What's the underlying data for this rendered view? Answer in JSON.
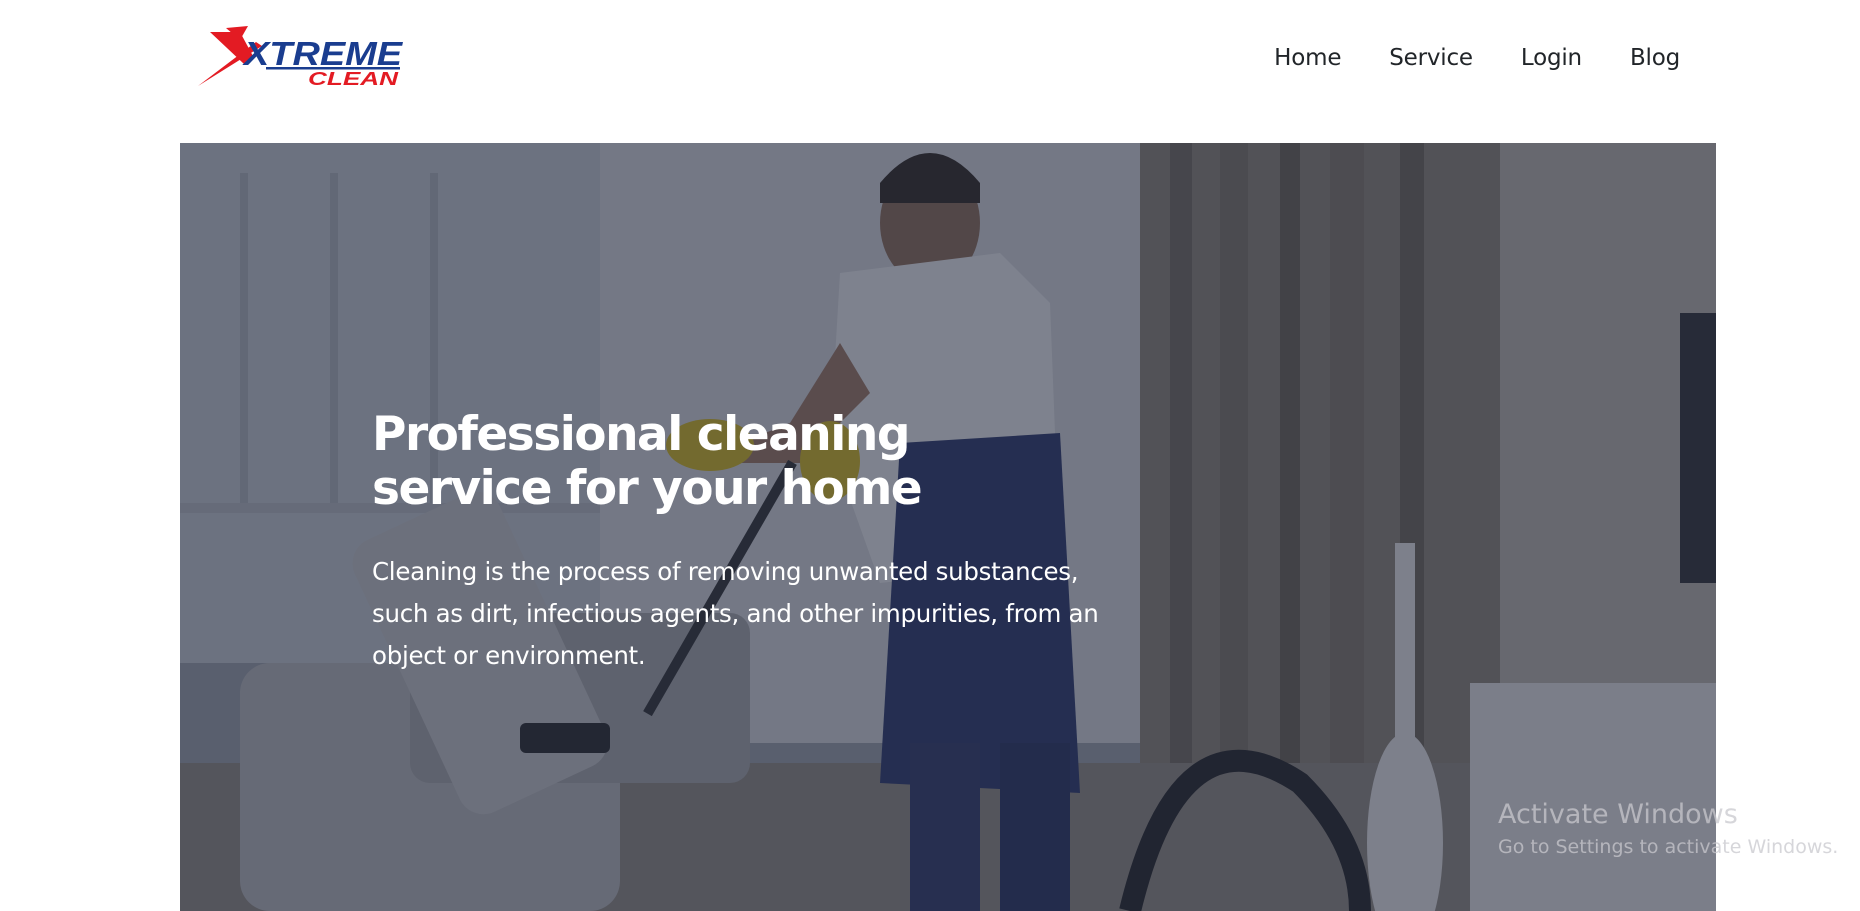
{
  "brand": {
    "logo_text_top": "XTREME",
    "logo_text_bottom": "CLEAN",
    "logo_color_red": "#e31b23",
    "logo_color_blue": "#1a3d8f"
  },
  "nav": {
    "items": [
      {
        "label": "Home"
      },
      {
        "label": "Service"
      },
      {
        "label": "Login"
      },
      {
        "label": "Blog"
      }
    ]
  },
  "hero": {
    "title_line1": "Professional cleaning",
    "title_line2": "service for your home",
    "description_line1": "Cleaning is the process of removing unwanted substances,",
    "description_line2": "such as dirt, infectious agents, and other impurities, from an",
    "description_line3": "object or environment.",
    "overlay_color": "#242a3c"
  },
  "os_watermark": {
    "title": "Activate Windows",
    "subtitle": "Go to Settings to activate Windows."
  }
}
